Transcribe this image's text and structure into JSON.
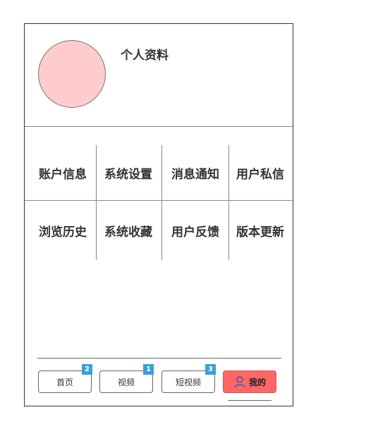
{
  "profile": {
    "title": "个人资料"
  },
  "menu": {
    "row1": [
      "账户信息",
      "系统设置",
      "消息通知",
      "用户私信"
    ],
    "row2": [
      "浏览历史",
      "系统收藏",
      "用户反馈",
      "版本更新"
    ]
  },
  "tabbar": {
    "tabs": [
      {
        "label": "首页",
        "badge": "2"
      },
      {
        "label": "视频",
        "badge": "1"
      },
      {
        "label": "短视频",
        "badge": "3"
      },
      {
        "label": "我的",
        "icon": "user-icon",
        "active": true
      }
    ]
  },
  "colors": {
    "avatar": "#ffcccc",
    "active_tab": "#ff6666",
    "badge": "#3aa0d8"
  }
}
